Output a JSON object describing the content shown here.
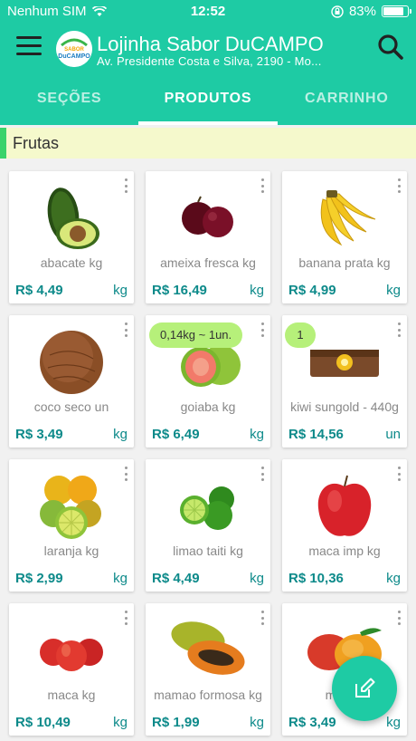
{
  "statusbar": {
    "carrier": "Nenhum SIM",
    "time": "12:52",
    "battery_percent": "83%",
    "battery_level": 0.83
  },
  "appbar": {
    "title": "Lojinha Sabor DuCAMPO",
    "subtitle": "Av. Presidente Costa e Silva, 2190 - Mo...",
    "logo_text_top": "SABOR",
    "logo_text_bottom": "DuCAMPO"
  },
  "tabs": [
    {
      "label": "SEÇÕES",
      "active": false
    },
    {
      "label": "PRODUTOS",
      "active": true
    },
    {
      "label": "CARRINHO",
      "active": false
    }
  ],
  "section": {
    "label": "Frutas"
  },
  "products": [
    {
      "name": "abacate kg",
      "price": "R$ 4,49",
      "unit": "kg",
      "icon": "avocado-icon"
    },
    {
      "name": "ameixa fresca kg",
      "price": "R$ 16,49",
      "unit": "kg",
      "icon": "plum-icon"
    },
    {
      "name": "banana prata kg",
      "price": "R$ 4,99",
      "unit": "kg",
      "icon": "banana-icon"
    },
    {
      "name": "coco seco un",
      "price": "R$ 3,49",
      "unit": "kg",
      "icon": "coconut-icon"
    },
    {
      "name": "goiaba kg",
      "price": "R$ 6,49",
      "unit": "kg",
      "icon": "guava-icon",
      "badge": "0,14kg ~ 1un."
    },
    {
      "name": "kiwi sungold - 440g",
      "price": "R$ 14,56",
      "unit": "un",
      "icon": "kiwi-box-icon",
      "badge": "1"
    },
    {
      "name": "laranja kg",
      "price": "R$ 2,99",
      "unit": "kg",
      "icon": "orange-icon"
    },
    {
      "name": "limao taiti kg",
      "price": "R$ 4,49",
      "unit": "kg",
      "icon": "lime-icon"
    },
    {
      "name": "maca imp kg",
      "price": "R$ 10,36",
      "unit": "kg",
      "icon": "red-apple-icon"
    },
    {
      "name": "maca kg",
      "price": "R$ 10,49",
      "unit": "kg",
      "icon": "apples-icon"
    },
    {
      "name": "mamao formosa kg",
      "price": "R$ 1,99",
      "unit": "kg",
      "icon": "papaya-icon"
    },
    {
      "name": "manga",
      "price": "R$ 3,49",
      "unit": "kg",
      "icon": "mango-icon"
    }
  ],
  "colors": {
    "primary": "#1ecba4",
    "price": "#0d8a8a",
    "badge": "#b6f07a",
    "section_bg": "#f5f9cc",
    "section_accent": "#3ad36a"
  }
}
